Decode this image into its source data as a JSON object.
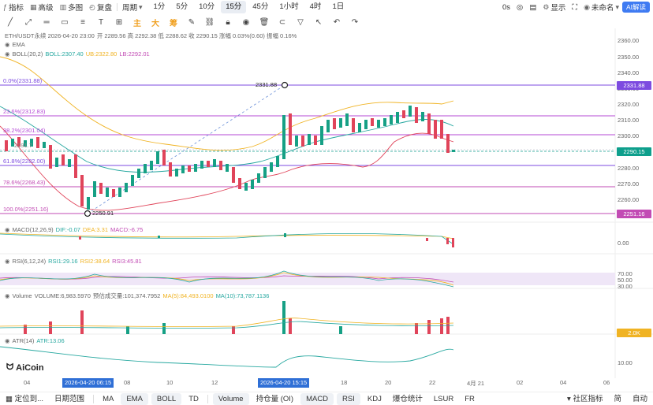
{
  "toolbar": {
    "indicators": "指标",
    "advanced": "高级",
    "multi": "多图",
    "replay": "复盘",
    "period": "周期",
    "intervals": [
      "1分",
      "5分",
      "10分",
      "15分",
      "45分",
      "1小时",
      "4时",
      "1日"
    ],
    "active_interval": "15分",
    "time_mode": "0s",
    "display": "显示",
    "user": "未命名",
    "ai_button": "AI解读"
  },
  "drawing": {
    "chars": [
      "主",
      "大",
      "筹"
    ]
  },
  "indicator_labels": {
    "symbol": "ETH/USDT永续 2026-04-20 23:00",
    "ohlc": "开 2289.56  高 2292.38  低 2288.62  收 2290.15  涨幅 0.03%(0.60)  振幅 0.16%",
    "ema": "EMA",
    "boll": "BOLL(20,2)",
    "boll_mid": "BOLL:2307.40",
    "boll_ub": "UB:2322.80",
    "boll_lb": "LB:2292.01",
    "macd": "MACD(12,26,9)",
    "macd_dif": "DIF:-0.07",
    "macd_dea": "DEA:3.31",
    "macd_val": "MACD:-6.75",
    "rsi": "RSI(6,12,24)",
    "rsi1": "RSI1:29.16",
    "rsi2": "RSI2:38.64",
    "rsi3": "RSI3:45.81",
    "volume": "Volume",
    "volume_val": "VOLUME:6,983.5970",
    "volume_est": "预估成交量:101,374.7952",
    "ma5": "MA(5):84,493.0100",
    "ma10": "MA(10):73,787.1136",
    "atr": "ATR(14)",
    "atr_val": "ATR:13.06"
  },
  "fib_levels": [
    {
      "label": "0.0%(2331.88)",
      "color": "#7d4be0"
    },
    {
      "label": "23.6%(2312.83)",
      "color": "#b54ad6"
    },
    {
      "label": "38.2%(2301.04)",
      "color": "#b54ad6"
    },
    {
      "label": "61.8%(2282.00)",
      "color": "#7d4be0"
    },
    {
      "label": "78.6%(2268.43)",
      "color": "#c24bb4"
    },
    {
      "label": "100.0%(2251.16)",
      "color": "#c24bb4"
    }
  ],
  "chart_annotations": {
    "high": "2331.88",
    "low": "2250.91",
    "mid_price": "2291.7"
  },
  "price_axis": [
    "2360.00",
    "2350.00",
    "2340.00",
    "2330.00",
    "2320.00",
    "2310.00",
    "2300.00",
    "2280.00",
    "2270.00",
    "2260.00"
  ],
  "price_tags": {
    "top": "2331.88",
    "current": "2290.15",
    "bottom": "2251.16",
    "colors": {
      "top": "#7d4be0",
      "current": "#0e9f8c",
      "bottom": "#c24bb4"
    }
  },
  "macd_axis": "0.00",
  "rsi_axis": [
    "70.00",
    "50.00",
    "30.00"
  ],
  "volume_axis": "2.0K",
  "atr_axis": "10.00",
  "time_axis": {
    "labels": [
      "04",
      "08",
      "10",
      "12",
      "18",
      "20",
      "22",
      "4月 21",
      "02",
      "04",
      "06"
    ],
    "badge_left": "2026-04-20 06:15",
    "badge_right": "2026-04-20 15:15"
  },
  "bottom": {
    "goto": "定位到...",
    "range": "日期范围",
    "items": [
      "MA",
      "EMA",
      "BOLL",
      "TD",
      "Volume",
      "持仓量 (OI)",
      "MACD",
      "RSI",
      "KDJ",
      "爆仓统计",
      "LSUR",
      "FR"
    ],
    "active_items": [
      "EMA",
      "BOLL",
      "Volume",
      "MACD",
      "RSI"
    ],
    "community": "社区指标",
    "simple": "简",
    "auto": "自动"
  },
  "logo": "AiCoin",
  "colors": {
    "up": "#16a085",
    "down": "#e0445a",
    "accent": "#2f6fd6"
  }
}
